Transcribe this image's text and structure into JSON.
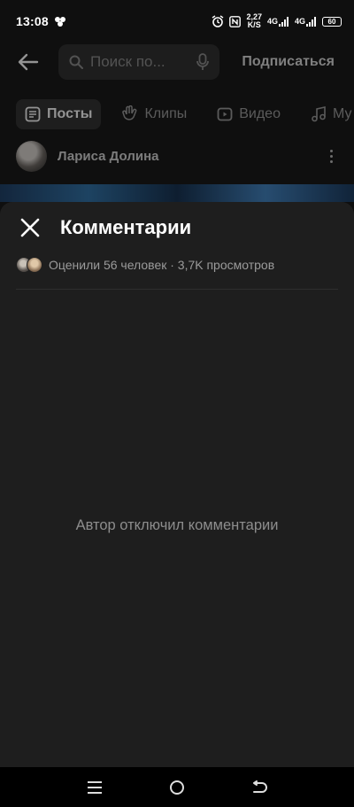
{
  "status_bar": {
    "time": "13:08",
    "network_speed_top": "2,27",
    "network_speed_bottom": "K/S",
    "signal1": "4G",
    "signal2": "4G",
    "battery": "60"
  },
  "background_page": {
    "search_placeholder": "Поиск по...",
    "subscribe_label": "Подписаться",
    "tabs": [
      {
        "label": "Посты",
        "icon": "posts-icon",
        "active": true
      },
      {
        "label": "Клипы",
        "icon": "clips-icon",
        "active": false
      },
      {
        "label": "Видео",
        "icon": "video-icon",
        "active": false
      },
      {
        "label": "Му",
        "icon": "music-icon",
        "active": false
      }
    ],
    "author_name": "Лариса Долина"
  },
  "comments_sheet": {
    "title": "Комментарии",
    "likes_text": "Оценили 56 человек · 3,7K просмотров",
    "empty_message": "Автор отключил комментарии"
  },
  "colors": {
    "sheet_background": "#1e1e1e",
    "page_background": "#0f0f0f",
    "secondary_text": "#9b9b9b"
  }
}
